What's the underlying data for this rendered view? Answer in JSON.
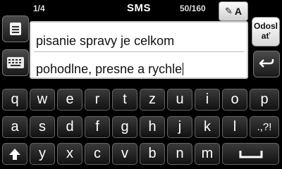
{
  "header": {
    "page_counter": "1/4",
    "title": "SMS",
    "char_counter": "50/160",
    "mode_icon": "pen-icon",
    "mode_letter": "A"
  },
  "buttons": {
    "send_line1": "Odosl",
    "send_line2": "ať",
    "menu_icon": "menu-icon",
    "keyboard_icon": "keyboard-icon",
    "back_icon": "return-arrow-icon"
  },
  "message": {
    "line1": "pisanie spravy je celkom",
    "line2": "pohodlne, presne a rychle"
  },
  "keyboard": {
    "row1": [
      "q",
      "w",
      "e",
      "r",
      "t",
      "z",
      "u",
      "i",
      "o",
      "p"
    ],
    "row2": [
      "a",
      "s",
      "d",
      "f",
      "g",
      "h",
      "j",
      "k",
      "l",
      ".,?!"
    ],
    "row3": [
      "y",
      "x",
      "c",
      "v",
      "b",
      "n",
      "m"
    ],
    "shift_icon": "shift-arrow-icon",
    "space_icon": "space-bar-icon"
  }
}
